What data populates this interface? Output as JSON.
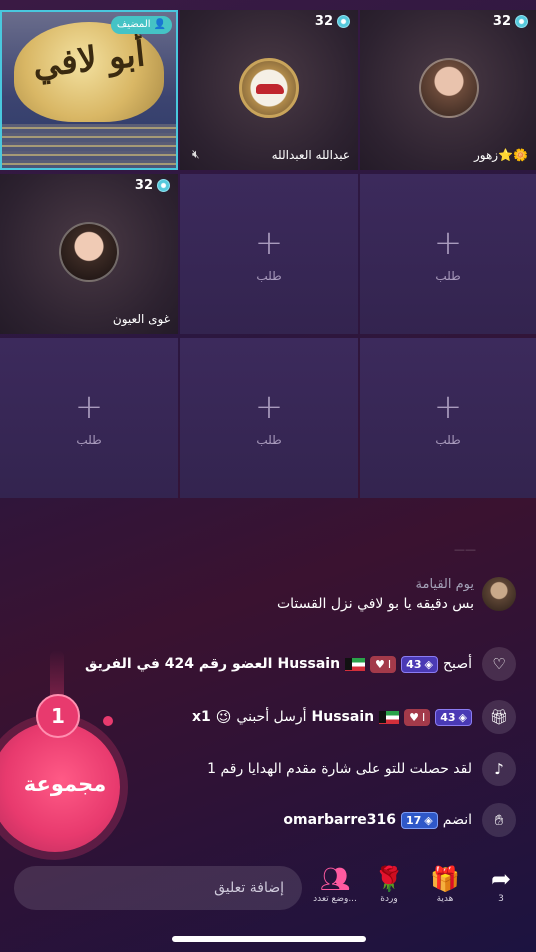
{
  "seats": [
    {
      "type": "host",
      "badge": "المضيف",
      "moon_text": "أبو لافي"
    },
    {
      "type": "occupied",
      "score": "32",
      "name": "عبدالله العبدالله"
    },
    {
      "type": "occupied",
      "score": "32",
      "name": "زهور⭐🌼"
    },
    {
      "type": "occupied",
      "score": "32",
      "name": "غوى العيون"
    },
    {
      "type": "empty",
      "label": "طلب"
    },
    {
      "type": "empty",
      "label": "طلب"
    },
    {
      "type": "empty",
      "label": "طلب"
    },
    {
      "type": "empty",
      "label": "طلب"
    },
    {
      "type": "empty",
      "label": "طلب"
    }
  ],
  "chat": {
    "message": {
      "name": "يوم القيامة",
      "text": "بس دقيقه يا بو لافي نزل القستات"
    },
    "rows": [
      {
        "icon": "heart-icon",
        "prefix": "أصبح",
        "level": "43",
        "heart_level": "I",
        "user": "Hussain",
        "suffix": "العضو رقم 424 في الفريق"
      },
      {
        "icon": "gift-icon",
        "level": "43",
        "heart_level": "I",
        "user": "Hussain",
        "suffix": "أرسل أحبني",
        "count": "x1"
      },
      {
        "icon": "tiktok-icon",
        "text": "لقد حصلت للتو على شارة مقدم الهدايا رقم 1"
      },
      {
        "icon": "wave-icon",
        "prefix": "انضم",
        "level": "17",
        "user": "omarbarre316"
      }
    ]
  },
  "group": {
    "count": "1",
    "label": "مجموعة"
  },
  "bottom": {
    "comment_placeholder": "إضافة تعليق",
    "actions": [
      {
        "icon": "multi-guest-icon",
        "label": "وضع تعدد..."
      },
      {
        "icon": "rose-icon",
        "label": "وردة"
      },
      {
        "icon": "gift-box-icon",
        "label": "هدية"
      },
      {
        "icon": "share-icon",
        "label": "3"
      }
    ]
  }
}
